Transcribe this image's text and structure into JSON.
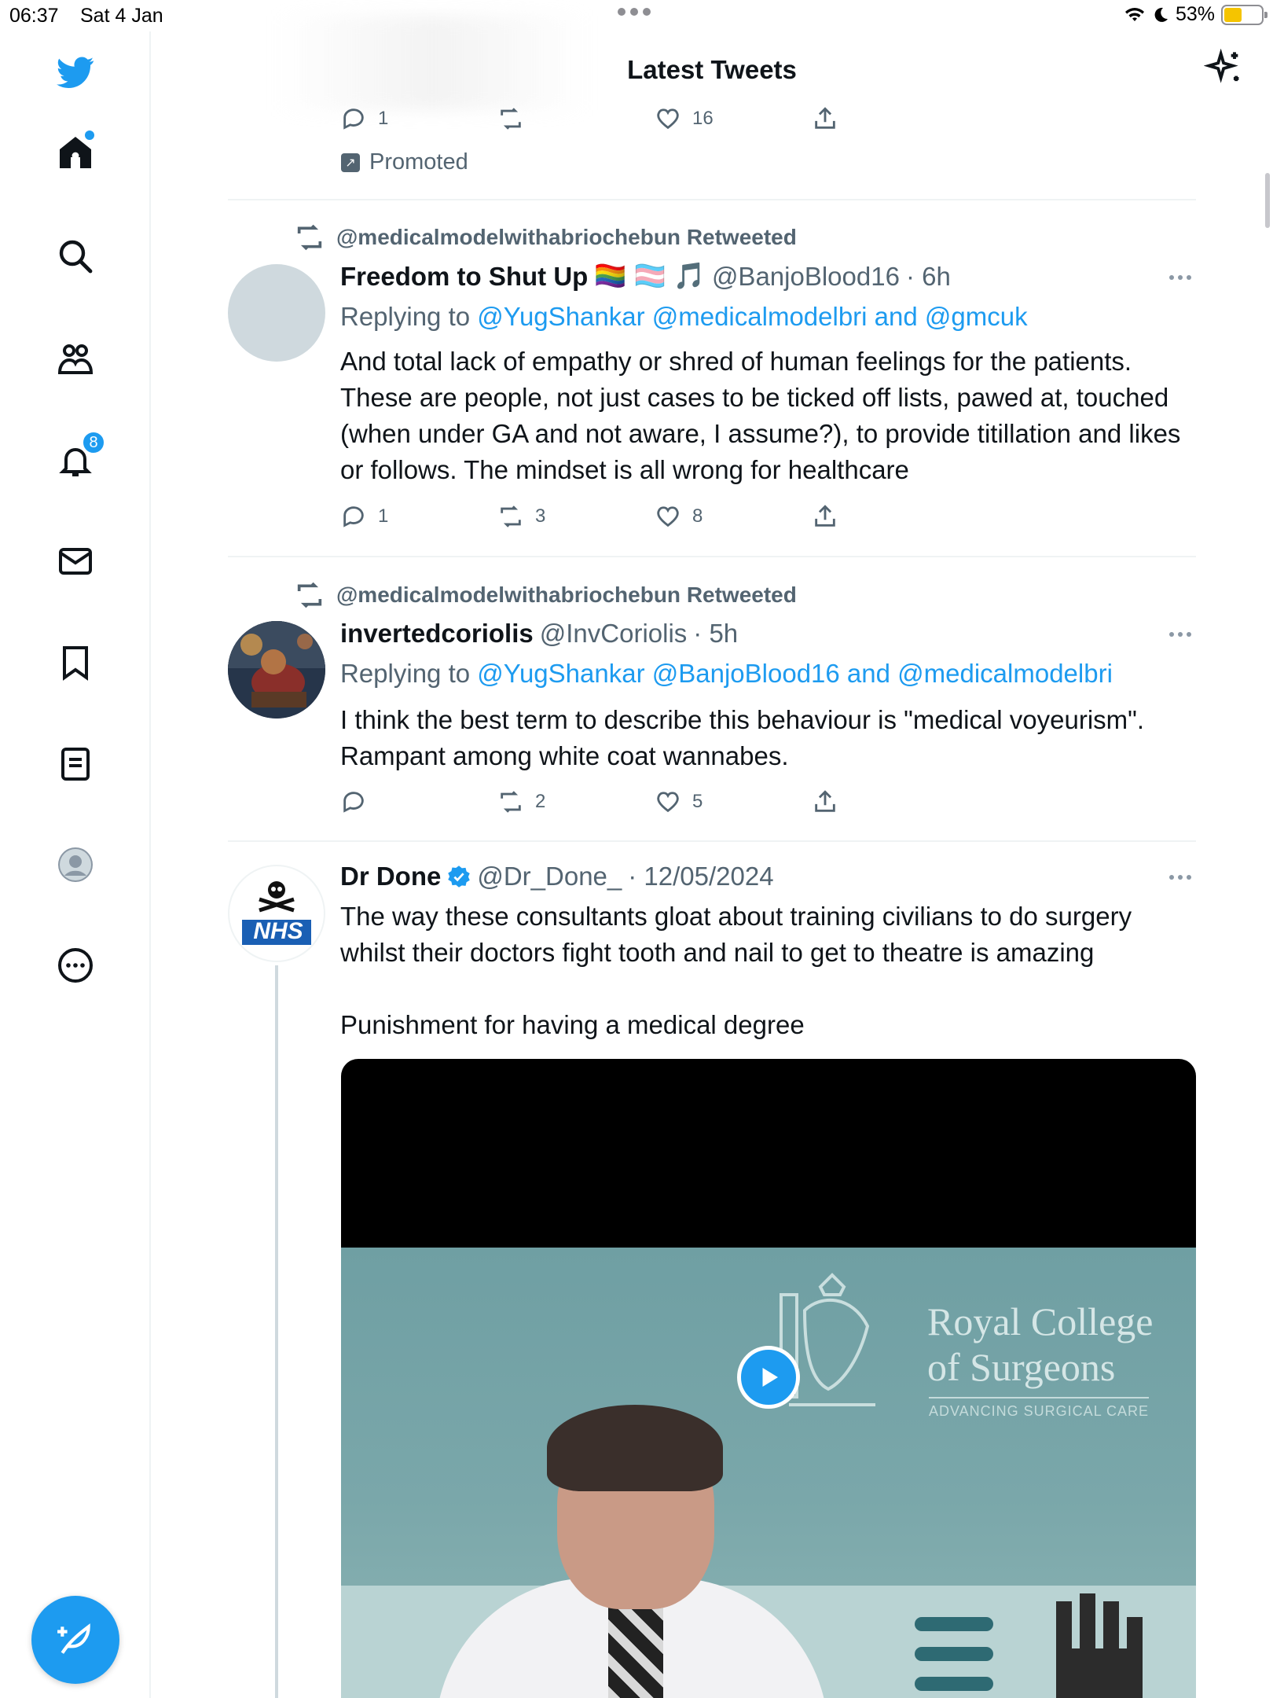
{
  "status_bar": {
    "time": "06:37",
    "date": "Sat 4 Jan",
    "battery": "53%"
  },
  "header": {
    "title": "Latest Tweets"
  },
  "sidebar": {
    "notifications_badge": "8",
    "items": [
      "bird-logo",
      "home-icon",
      "search-icon",
      "communities-icon",
      "notifications-icon",
      "messages-icon",
      "bookmarks-icon",
      "lists-icon",
      "profile-icon",
      "more-icon"
    ]
  },
  "promoted_tweet": {
    "replies": "1",
    "retweets": "",
    "likes": "16",
    "label": "Promoted"
  },
  "tweets": [
    {
      "retweeted_by": "@medicalmodelwithabriochebun Retweeted",
      "name": "Freedom to Shut Up",
      "emoji": "🏳️‍🌈 🏳️‍⚧️ 🎵",
      "handle": "@BanjoBlood16",
      "time": "· 6h",
      "replying_prefix": "Replying to ",
      "replying_to": "@YugShankar @medicalmodelbri and @gmcuk",
      "text": "And total lack of empathy or shred of human feelings for the patients. These are people, not just cases to be ticked off lists, pawed at, touched (when under GA and not aware, I assume?), to provide titillation and likes or follows. The mindset is all wrong for healthcare",
      "replies": "1",
      "retweets": "3",
      "likes": "8"
    },
    {
      "retweeted_by": "@medicalmodelwithabriochebun Retweeted",
      "name": "invertedcoriolis",
      "handle": "@InvCoriolis",
      "time": "· 5h",
      "replying_prefix": "Replying to ",
      "replying_to": "@YugShankar @BanjoBlood16 and @medicalmodelbri",
      "text": "I think the best term to describe this behaviour is \"medical voyeurism\". Rampant among white coat wannabes.",
      "replies": "",
      "retweets": "2",
      "likes": "5"
    },
    {
      "name": "Dr Done",
      "handle": "@Dr_Done_",
      "time": "· 12/05/2024",
      "avatar_label": "NHS",
      "text_1": "The way these consultants gloat about training civilians to do surgery whilst their doctors fight tooth and nail to get to theatre is amazing",
      "text_2": "Punishment for having a medical degree",
      "media": {
        "line1": "Royal College",
        "line2": "of Surgeons",
        "sub": "ADVANCING SURGICAL CARE"
      }
    }
  ],
  "colors": {
    "accent": "#1d9bf0",
    "text": "#0f1419",
    "muted": "#536471"
  }
}
